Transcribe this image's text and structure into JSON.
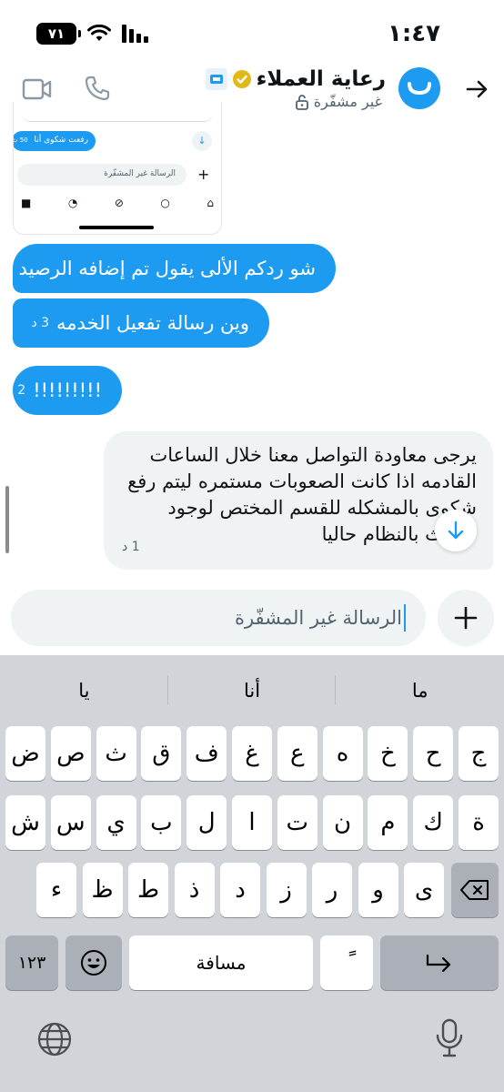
{
  "status_bar": {
    "time": "١:٤٧",
    "battery": "٧١"
  },
  "header": {
    "title": "رعاية العملاء",
    "subtitle": "غير مشفّرة"
  },
  "shared_screenshot": {
    "message": "رفعت شكوى أنا",
    "timestamp": "50 ث",
    "input_placeholder": "الرسالة غير المشفّرة"
  },
  "messages": [
    {
      "text": "شو ردكم الألى يقول تم إضافه الرصيد",
      "time": ""
    },
    {
      "text": "وين رسالة تفعيل الخدمه",
      "time": "3 د"
    },
    {
      "text": "!!!!!!!!!",
      "time": "2 د"
    }
  ],
  "incoming_message": {
    "lines": [
      "يرجى معاودة التواصل معنا خلال الساعات",
      "القادمه اذا كانت الصعوبات مستمره ليتم رفع",
      "شكوى بالمشكله للقسم المختص  لوجود",
      "تحديث بالنظام حاليا"
    ],
    "time": "1 د"
  },
  "compose": {
    "placeholder": "الرسالة غير المشفّرة"
  },
  "keyboard": {
    "suggestions": [
      "ما",
      "أنا",
      "يا"
    ],
    "row1": [
      "ج",
      "ح",
      "خ",
      "ه",
      "ع",
      "غ",
      "ف",
      "ق",
      "ث",
      "ص",
      "ض"
    ],
    "row2": [
      "ة",
      "ك",
      "م",
      "ن",
      "ت",
      "ا",
      "ل",
      "ب",
      "ي",
      "س",
      "ش"
    ],
    "row3": [
      "ى",
      "و",
      "ر",
      "ز",
      "د",
      "ذ",
      "ط",
      "ظ",
      "ء"
    ],
    "numbers_label": "١٢٣",
    "space_label": "مسافة",
    "diacritic_label": "ً"
  },
  "colors": {
    "accent": "#1d9bf0",
    "incoming_bg": "#eff3f4",
    "keyboard_bg": "#d1d4d9"
  }
}
